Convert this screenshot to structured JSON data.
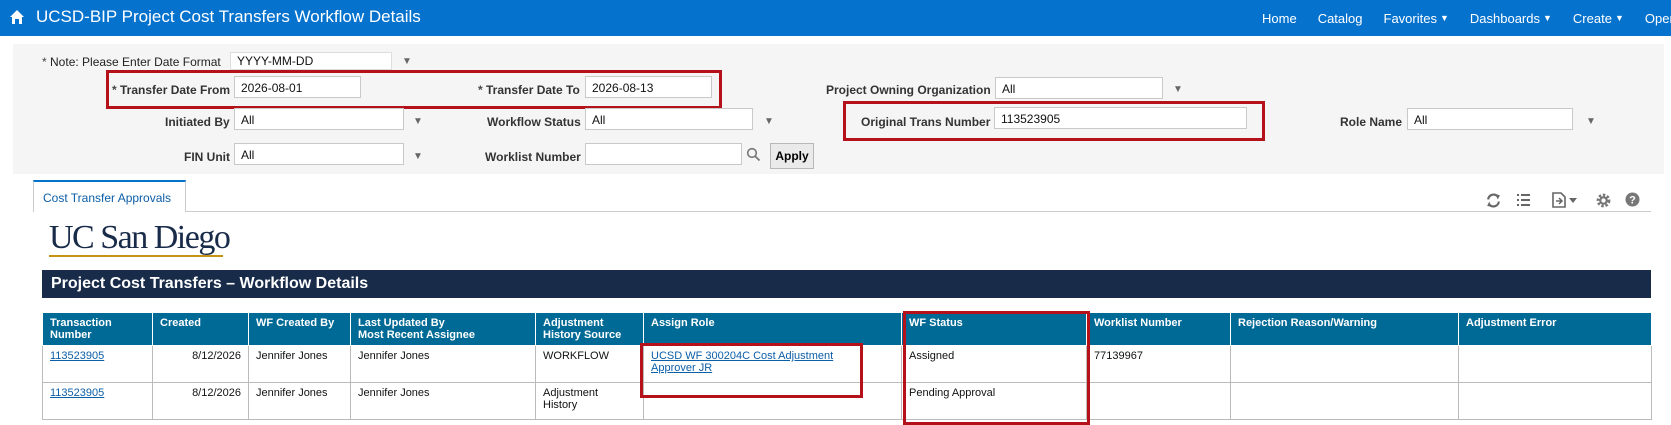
{
  "header": {
    "title": "UCSD-BIP Project Cost Transfers Workflow Details",
    "nav": [
      {
        "label": "Home",
        "dropdown": false
      },
      {
        "label": "Catalog",
        "dropdown": false
      },
      {
        "label": "Favorites",
        "dropdown": true
      },
      {
        "label": "Dashboards",
        "dropdown": true
      },
      {
        "label": "Create",
        "dropdown": true
      },
      {
        "label": "Open",
        "dropdown": true
      }
    ]
  },
  "prompts": {
    "note_label": "Note: Please Enter Date Format",
    "note_value": "YYYY-MM-DD",
    "transfer_from_label": "Transfer Date From",
    "transfer_from_value": "2026-08-01",
    "transfer_to_label": "Transfer Date To",
    "transfer_to_value": "2026-08-13",
    "owning_org_label": "Project Owning Organization",
    "owning_org_value": "All",
    "initiated_by_label": "Initiated By",
    "initiated_by_value": "All",
    "workflow_status_label": "Workflow Status",
    "workflow_status_value": "All",
    "orig_trans_label": "Original Trans Number",
    "orig_trans_value": "113523905",
    "role_name_label": "Role Name",
    "role_name_value": "All",
    "fin_unit_label": "FIN Unit",
    "fin_unit_value": "All",
    "worklist_label": "Worklist Number",
    "worklist_value": "",
    "apply_label": "Apply"
  },
  "tab": {
    "label": "Cost Transfer Approvals"
  },
  "report": {
    "logo_text": "UC San Diego",
    "banner": "Project Cost Transfers – Workflow Details",
    "columns": [
      {
        "l1": "Transaction",
        "l2": "Number"
      },
      {
        "l1": "Created",
        "l2": ""
      },
      {
        "l1": "WF Created By",
        "l2": ""
      },
      {
        "l1": "Last Updated By",
        "l2": "Most Recent Assignee"
      },
      {
        "l1": "Adjustment",
        "l2": "History Source"
      },
      {
        "l1": "Assign Role",
        "l2": ""
      },
      {
        "l1": "WF Status",
        "l2": ""
      },
      {
        "l1": "Worklist Number",
        "l2": ""
      },
      {
        "l1": "Rejection Reason/Warning",
        "l2": ""
      },
      {
        "l1": "Adjustment Error",
        "l2": ""
      }
    ],
    "rows": [
      {
        "txn": "113523905",
        "created": "8/12/2026",
        "wf_created_by": "Jennifer Jones",
        "last_updated_by": "Jennifer Jones",
        "source": "WORKFLOW",
        "source2": "",
        "role_l1": "UCSD WF 300204C Cost Adjustment",
        "role_l2": "Approver JR",
        "status": "Assigned",
        "worklist": "77139967",
        "rejection": "",
        "error": ""
      },
      {
        "txn": "113523905",
        "created": "8/12/2026",
        "wf_created_by": "Jennifer Jones",
        "last_updated_by": "Jennifer Jones",
        "source": "Adjustment",
        "source2": "History",
        "role_l1": "",
        "role_l2": "",
        "status": "Pending Approval",
        "worklist": "",
        "rejection": "",
        "error": ""
      }
    ]
  },
  "colors": {
    "topbar": "#0572ce",
    "banner": "#182b49",
    "table_header": "#006a96",
    "highlight": "#b5111b",
    "accent_gold": "#c69214"
  }
}
